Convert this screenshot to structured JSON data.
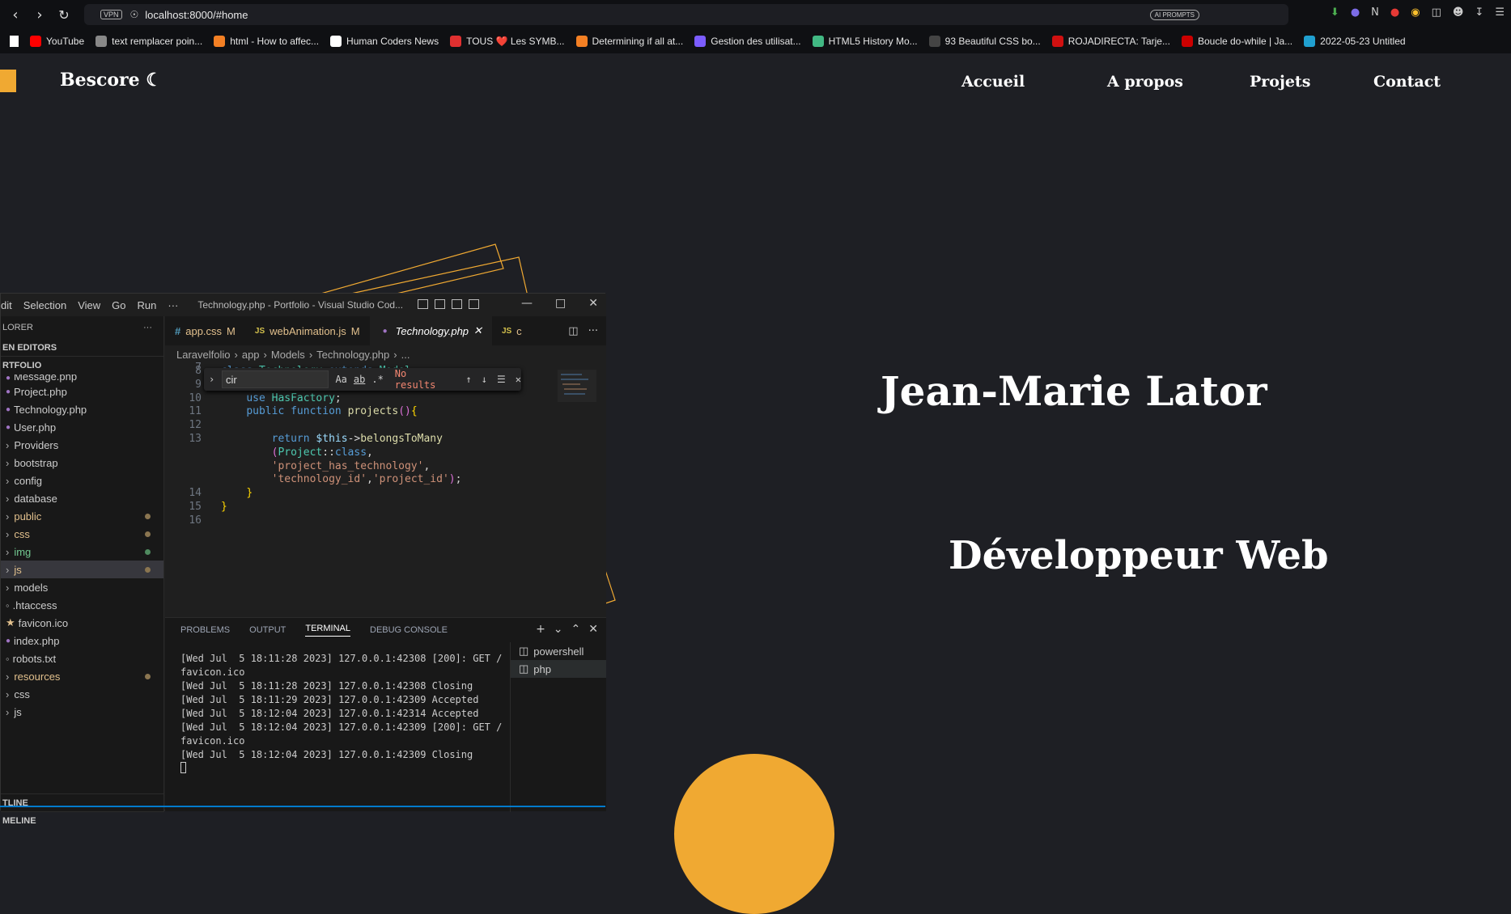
{
  "browser": {
    "url": "localhost:8000/#home",
    "vpn_label": "VPN",
    "ai_prompts_label": "AI PROMPTS",
    "bookmarks": [
      {
        "label": "YouTube",
        "color": "#ff0000"
      },
      {
        "label": "text remplacer poin...",
        "color": "#888888"
      },
      {
        "label": "html - How to affec...",
        "color": "#f48024"
      },
      {
        "label": "Human Coders News",
        "color": "#ffffff"
      },
      {
        "label": "TOUS ❤️ Les SYMB...",
        "color": "#e03030"
      },
      {
        "label": "Determining if all at...",
        "color": "#f48024"
      },
      {
        "label": "Gestion des utilisat...",
        "color": "#7b5cff"
      },
      {
        "label": "HTML5 History Mo...",
        "color": "#41b883"
      },
      {
        "label": "93 Beautiful CSS bo...",
        "color": "#444444"
      },
      {
        "label": "ROJADIRECTA: Tarje...",
        "color": "#d01010"
      },
      {
        "label": "Boucle do-while | Ja...",
        "color": "#cc0000"
      },
      {
        "label": "2022-05-23 Untitled",
        "color": "#20a0d0"
      }
    ]
  },
  "site": {
    "brand": "Bescore ☾",
    "nav": [
      "Accueil",
      "A propos",
      "Projets",
      "Contact"
    ],
    "hero_name": "Jean-Marie Lator",
    "hero_role": "Développeur Web",
    "accent": "#f0a932"
  },
  "vscode": {
    "menu": [
      "dit",
      "Selection",
      "View",
      "Go",
      "Run",
      "···"
    ],
    "title": "Technology.php - Portfolio - Visual Studio Cod...",
    "explorer_header": "LORER",
    "open_editors": "EN EDITORS",
    "folder": "RTFOLIO",
    "files": [
      {
        "label": "Message.php",
        "type": "php",
        "modified": false
      },
      {
        "label": "Project.php",
        "type": "php",
        "modified": false
      },
      {
        "label": "Technology.php",
        "type": "php",
        "modified": false
      },
      {
        "label": "User.php",
        "type": "php",
        "modified": false
      },
      {
        "label": "Providers",
        "type": "folder",
        "modified": false
      },
      {
        "label": "bootstrap",
        "type": "folder",
        "modified": false
      },
      {
        "label": "config",
        "type": "folder",
        "modified": false
      },
      {
        "label": "database",
        "type": "folder",
        "modified": false
      },
      {
        "label": "public",
        "type": "folder-mod",
        "modified": true
      },
      {
        "label": "css",
        "type": "folder-mod",
        "modified": true
      },
      {
        "label": "img",
        "type": "folder-new",
        "modified": true
      },
      {
        "label": "js",
        "type": "folder-mod-active",
        "modified": true
      },
      {
        "label": "models",
        "type": "folder",
        "modified": false
      },
      {
        "label": ".htaccess",
        "type": "file",
        "modified": false
      },
      {
        "label": "favicon.ico",
        "type": "fav",
        "modified": false
      },
      {
        "label": "index.php",
        "type": "php",
        "modified": false
      },
      {
        "label": "robots.txt",
        "type": "file",
        "modified": false
      },
      {
        "label": "resources",
        "type": "folder-mod",
        "modified": true
      },
      {
        "label": "css",
        "type": "folder",
        "modified": false
      },
      {
        "label": "js",
        "type": "folder",
        "modified": false
      }
    ],
    "outline": "TLINE",
    "timeline": "MELINE",
    "tabs": [
      {
        "label": "app.css",
        "icon": "#",
        "mod": "M",
        "active": false
      },
      {
        "label": "webAnimation.js",
        "icon": "JS",
        "mod": "M",
        "active": false
      },
      {
        "label": "Technology.php",
        "icon": "php",
        "mod": "✕",
        "active": true
      },
      {
        "label": "c",
        "icon": "JS",
        "mod": "",
        "active": false
      }
    ],
    "breadcrumbs": [
      "Laravelfolio",
      "app",
      "Models",
      "Technology.php",
      "..."
    ],
    "find": {
      "query": "cir",
      "status": "No results"
    },
    "code_lines": [
      {
        "n": "7",
        "text": ""
      },
      {
        "n": "8",
        "text": "class Technology extends Model"
      },
      {
        "n": "9",
        "text": "{"
      },
      {
        "n": "10",
        "text": "    use HasFactory;"
      },
      {
        "n": "11",
        "text": "    public function projects(){"
      },
      {
        "n": "12",
        "text": ""
      },
      {
        "n": "13",
        "text": "        return $this->belongsToMany"
      },
      {
        "n": "",
        "text": "        (Project::class,"
      },
      {
        "n": "",
        "text": "        'project_has_technology',"
      },
      {
        "n": "",
        "text": "        'technology_id','project_id');"
      },
      {
        "n": "14",
        "text": "    }"
      },
      {
        "n": "15",
        "text": "}"
      },
      {
        "n": "16",
        "text": ""
      }
    ],
    "panel_tabs": [
      "PROBLEMS",
      "OUTPUT",
      "TERMINAL",
      "DEBUG CONSOLE"
    ],
    "terminal_lines": [
      "[Wed Jul  5 18:11:28 2023] 127.0.0.1:42308 [200]: GET /",
      "favicon.ico",
      "[Wed Jul  5 18:11:28 2023] 127.0.0.1:42308 Closing",
      "[Wed Jul  5 18:11:29 2023] 127.0.0.1:42309 Accepted",
      "[Wed Jul  5 18:12:04 2023] 127.0.0.1:42314 Accepted",
      "[Wed Jul  5 18:12:04 2023] 127.0.0.1:42309 [200]: GET /",
      "favicon.ico",
      "[Wed Jul  5 18:12:04 2023] 127.0.0.1:42309 Closing"
    ],
    "terminals": [
      "powershell",
      "php"
    ]
  }
}
